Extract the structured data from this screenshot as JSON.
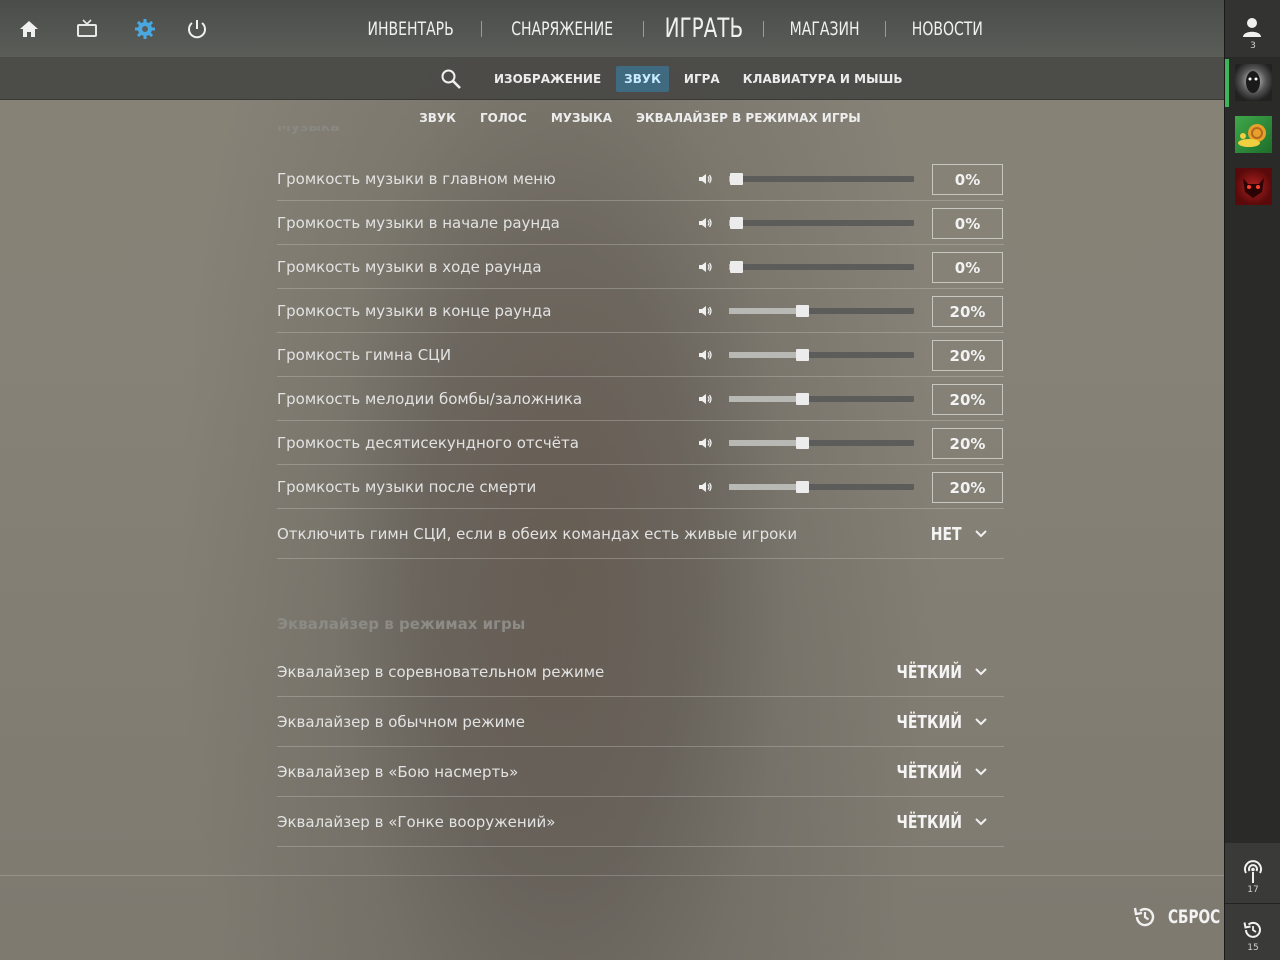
{
  "top_nav": {
    "items": [
      "ИНВЕНТАРЬ",
      "СНАРЯЖЕНИЕ",
      "ИГРАТЬ",
      "МАГАЗИН",
      "НОВОСТИ"
    ],
    "icons": [
      "home-icon",
      "tv-icon",
      "gear-icon",
      "power-icon"
    ]
  },
  "tabs": {
    "items": [
      "ИЗОБРАЖЕНИЕ",
      "ЗВУК",
      "ИГРА",
      "КЛАВИАТУРА И МЫШЬ"
    ],
    "active": "ЗВУК"
  },
  "subtabs": [
    "ЗВУК",
    "ГОЛОС",
    "МУЗЫКА",
    "ЭКВАЛАЙЗЕР В РЕЖИМАХ ИГРЫ"
  ],
  "music_section_title": "Музыка",
  "sliders": [
    {
      "label": "Громкость музыки в главном меню",
      "value": "0%",
      "level": 0.0
    },
    {
      "label": "Громкость музыки в начале раунда",
      "value": "0%",
      "level": 0.0
    },
    {
      "label": "Громкость музыки в ходе раунда",
      "value": "0%",
      "level": 0.0
    },
    {
      "label": "Громкость музыки в конце раунда",
      "value": "20%",
      "level": 0.2
    },
    {
      "label": "Громкость гимна СЦИ",
      "value": "20%",
      "level": 0.2
    },
    {
      "label": "Громкость мелодии бомбы/заложника",
      "value": "20%",
      "level": 0.2
    },
    {
      "label": "Громкость десятисекундного отсчёта",
      "value": "20%",
      "level": 0.2
    },
    {
      "label": "Громкость музыки после смерти",
      "value": "20%",
      "level": 0.2
    }
  ],
  "anthem_toggle": {
    "label": "Отключить гимн СЦИ, если в обеих командах есть живые игроки",
    "value": "НЕТ"
  },
  "eq_section_title": "Эквалайзер в режимах игры",
  "eq_rows": [
    {
      "label": "Эквалайзер в соревновательном режиме",
      "value": "ЧЁТКИЙ"
    },
    {
      "label": "Эквалайзер в обычном режиме",
      "value": "ЧЁТКИЙ"
    },
    {
      "label": "Эквалайзер в «Бою насмерть»",
      "value": "ЧЁТКИЙ"
    },
    {
      "label": "Эквалайзер в «Гонке вооружений»",
      "value": "ЧЁТКИЙ"
    }
  ],
  "reset_label": "СБРОС",
  "sidebar": {
    "friends_count": "3",
    "broadcast_count": "17",
    "history_count": "15"
  },
  "colors": {
    "active_tab_bg": "#3f6a80",
    "active_tab_text": "#c8eaff",
    "active_avatar_indicator": "#3fb55a"
  }
}
